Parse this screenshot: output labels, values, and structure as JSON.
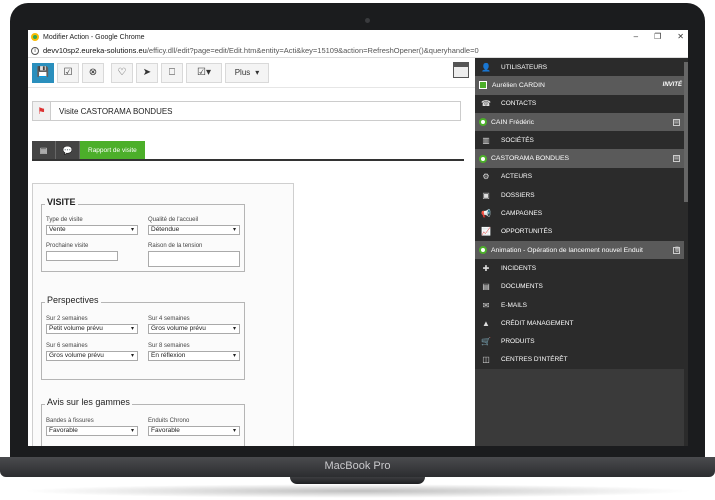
{
  "laptop": {
    "brand": "MacBook Pro"
  },
  "browser": {
    "window_title": "Modifier Action - Google Chrome",
    "url_host": "devv10sp2.eureka-solutions.eu",
    "url_path": "/efficy.dll/edit?page=edit/Edit.htm&entity=Acti&key=15109&action=RefreshOpener()&queryhandle=0",
    "controls": {
      "minimize": "–",
      "maximize": "❐",
      "close": "✕"
    }
  },
  "toolbar": {
    "save_icon": "💾",
    "check_icon": "☑",
    "cancel_icon": "⊗",
    "favorite_icon": "♡",
    "send_icon": "➤",
    "bookmark_icon": "⎕",
    "task_icon": "☑▾",
    "plus_label": "Plus",
    "plus_caret": "▾",
    "calendar_icon": "▦"
  },
  "record": {
    "title": "Visite CASTORAMA BONDUES",
    "flag_icon": "⚑"
  },
  "tabs": {
    "tab1_icon": "▤",
    "tab2_icon": "💬",
    "active_label": "Rapport de visite"
  },
  "form": {
    "visite": {
      "title": "VISITE",
      "type_label": "Type de visite",
      "type_value": "Vente",
      "qualite_label": "Qualité de l'accueil",
      "qualite_value": "Détendue",
      "prochaine_label": "Prochaine visite",
      "prochaine_value": "",
      "tension_label": "Raison de la tension",
      "tension_value": ""
    },
    "perspectives": {
      "title": "Perspectives",
      "s2_label": "Sur 2 semaines",
      "s2_value": "Petit volume prévu",
      "s4_label": "Sur 4 semaines",
      "s4_value": "Gros volume prévu",
      "s6_label": "Sur 6 semaines",
      "s6_value": "Gros volume prévu",
      "s8_label": "Sur 8 semaines",
      "s8_value": "En réflexion"
    },
    "gammes": {
      "title": "Avis sur les gammes",
      "bandes_label": "Bandes à fissures",
      "bandes_value": "Favorable",
      "enduits_label": "Enduits Chrono",
      "enduits_value": "Favorable"
    }
  },
  "sidebar": {
    "items": [
      {
        "kind": "head",
        "icon": "👤",
        "label": "UTILISATEURS"
      },
      {
        "kind": "entry",
        "marker": "square",
        "label": "Aurélien CARDIN",
        "right": "INVITÉ"
      },
      {
        "kind": "head",
        "icon": "☎",
        "label": "CONTACTS"
      },
      {
        "kind": "entry",
        "marker": "dot",
        "label": "CAIN Frédéric",
        "mini": "▤"
      },
      {
        "kind": "head",
        "icon": "▥",
        "label": "SOCIÉTÉS"
      },
      {
        "kind": "entry",
        "marker": "dot",
        "label": "CASTORAMA BONDUES",
        "mini": "▤"
      },
      {
        "kind": "head",
        "icon": "⚙",
        "label": "ACTEURS"
      },
      {
        "kind": "head",
        "icon": "▣",
        "label": "DOSSIERS"
      },
      {
        "kind": "head",
        "icon": "📢",
        "label": "CAMPAGNES"
      },
      {
        "kind": "head",
        "icon": "📈",
        "label": "OPPORTUNITÉS"
      },
      {
        "kind": "entry",
        "marker": "dot",
        "label": "Animation - Opération de lancement nouvel Enduit",
        "mini": "🗑"
      },
      {
        "kind": "head",
        "icon": "✚",
        "label": "INCIDENTS"
      },
      {
        "kind": "head",
        "icon": "▤",
        "label": "DOCUMENTS"
      },
      {
        "kind": "head",
        "icon": "✉",
        "label": "E-MAILS"
      },
      {
        "kind": "head",
        "icon": "▲",
        "label": "CRÉDIT MANAGEMENT"
      },
      {
        "kind": "head",
        "icon": "🛒",
        "label": "PRODUITS"
      },
      {
        "kind": "head",
        "icon": "◫",
        "label": "CENTRES D'INTÉRÊT"
      }
    ]
  }
}
